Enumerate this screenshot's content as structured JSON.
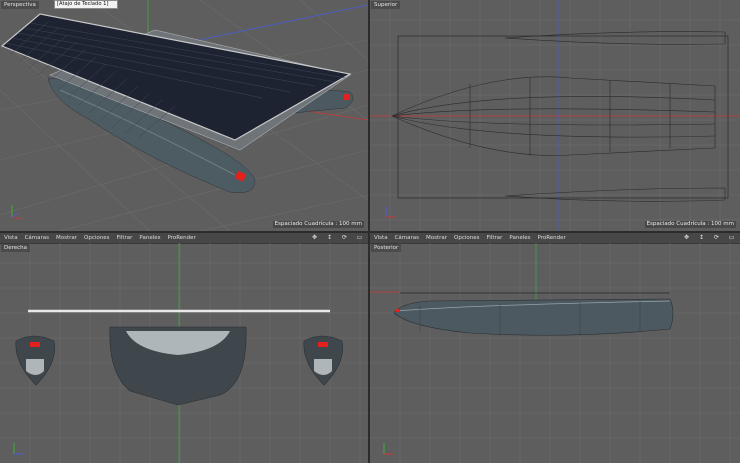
{
  "viewports": {
    "perspective": {
      "title": "Perspectiva",
      "tooltip": {
        "line1": "",
        "line2": "[Atajo de Teclado 1]"
      },
      "grid_spacing": "Espaciado Cuadrícula : 100 mm"
    },
    "top": {
      "title": "Superior",
      "grid_spacing": "Espaciado Cuadrícula : 100 mm"
    },
    "right": {
      "title": "Derecha",
      "menu": [
        "Vista",
        "Cámaras",
        "Mostrar",
        "Opciones",
        "Filtrar",
        "Paneles",
        "ProRender"
      ]
    },
    "back": {
      "title": "Posterior",
      "menu": [
        "Vista",
        "Cámaras",
        "Mostrar",
        "Opciones",
        "Filtrar",
        "Paneles",
        "ProRender"
      ]
    }
  },
  "nav_icons": [
    "move-view-icon",
    "zoom-view-icon",
    "rotate-view-icon",
    "maximize-view-icon"
  ],
  "colors": {
    "viewport_bg": "#5e5e5e",
    "grid_line": "#6e6e6e",
    "axis_x": "#c63a3a",
    "axis_y": "#3fae3f",
    "axis_z": "#4a5cd6",
    "hull": "#4c5960",
    "panel": "#1d2331",
    "marker": "#e2211c"
  }
}
